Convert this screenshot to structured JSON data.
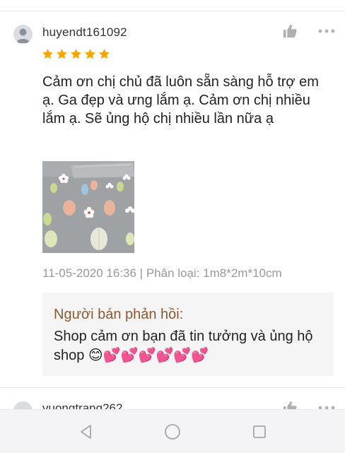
{
  "review": {
    "username": "huyendt161092",
    "rating": 5,
    "comment": "Cảm ơn chị chủ đã luôn sẵn sàng hỗ trợ em ạ. Ga đẹp và ưng lắm ạ. Cảm ơn chị nhiều lắm ạ. Sẽ ủng hộ chị nhiều lần nữa ạ",
    "meta": "11-05-2020 16:36 | Phân loại: 1m8*2m*10cm",
    "seller_reply": {
      "title": "Người bán phản hồi:",
      "text": "Shop cảm ơn bạn đã tin tưởng và ủng hộ shop 😊💕💕💕💕💕💕"
    },
    "icons": {
      "like": "thumbs-up-icon",
      "more": "more-options-icon",
      "star": "star-icon"
    }
  },
  "next_review": {
    "username": "vuongtrang262"
  },
  "colors": {
    "star": "#f6a700",
    "reply_title": "#8a5a34",
    "meta": "#999999",
    "reply_bg": "#f5f5f5",
    "icon": "#b0b0b0"
  },
  "navbar": {
    "back": "back-triangle-icon",
    "home": "home-circle-icon",
    "recents": "recents-square-icon"
  }
}
